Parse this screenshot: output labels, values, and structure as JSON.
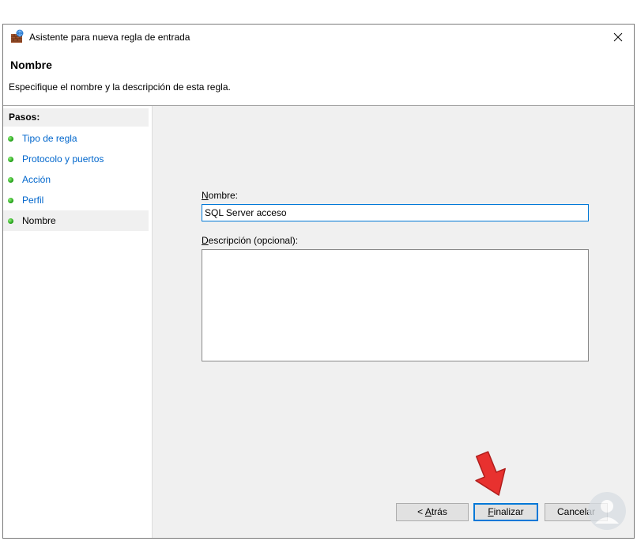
{
  "window": {
    "title": "Asistente para nueva regla de entrada",
    "icon": "firewall-icon",
    "close_icon": "close-icon"
  },
  "header": {
    "title": "Nombre",
    "description": "Especifique el nombre y la descripción de esta regla."
  },
  "steps": {
    "title": "Pasos:",
    "items": [
      {
        "label": "Tipo de regla",
        "active": false
      },
      {
        "label": "Protocolo y puertos",
        "active": false
      },
      {
        "label": "Acción",
        "active": false
      },
      {
        "label": "Perfil",
        "active": false
      },
      {
        "label": "Nombre",
        "active": true
      }
    ]
  },
  "form": {
    "name_label_mnemonic": "N",
    "name_label_rest": "ombre:",
    "name_value": "SQL Server acceso",
    "description_label_mnemonic": "D",
    "description_label_rest": "escripción (opcional):",
    "description_value": ""
  },
  "buttons": {
    "back_prefix": "< ",
    "back_mnemonic": "A",
    "back_rest": "trás",
    "finish_mnemonic": "F",
    "finish_rest": "inalizar",
    "cancel_label": "Cancelar"
  },
  "colors": {
    "accent": "#0078d7",
    "link": "#0066cc",
    "panel_bg": "#f0f0f0",
    "annotation_arrow": "#e8312f"
  }
}
